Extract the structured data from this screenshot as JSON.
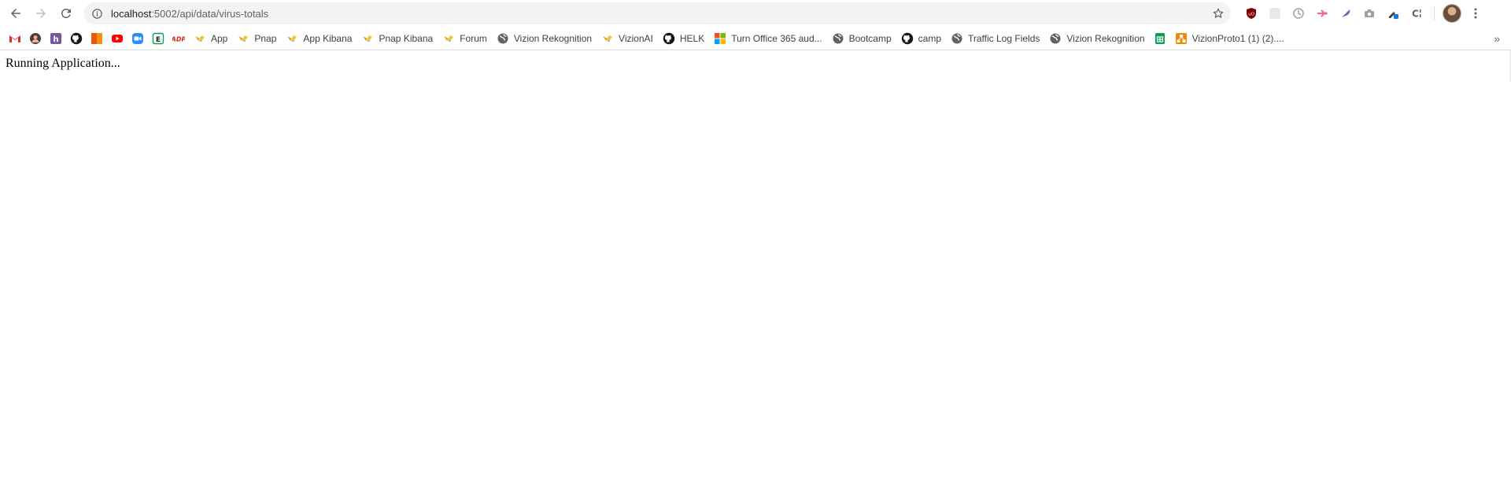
{
  "toolbar": {
    "url_host": "localhost",
    "url_path": ":5002/api/data/virus-totals"
  },
  "bookmarks": {
    "items": [
      {
        "label": "",
        "icon": "gmail-icon"
      },
      {
        "label": "",
        "icon": "avatar-bookmark-icon"
      },
      {
        "label": "",
        "icon": "heroku-icon"
      },
      {
        "label": "",
        "icon": "github-icon"
      },
      {
        "label": "",
        "icon": "orange-bookmark-icon"
      },
      {
        "label": "",
        "icon": "youtube-icon"
      },
      {
        "label": "",
        "icon": "zoom-icon"
      },
      {
        "label": "",
        "icon": "evernote-e-icon"
      },
      {
        "label": "",
        "icon": "adp-icon"
      },
      {
        "label": "App",
        "icon": "kibana-leaf-icon"
      },
      {
        "label": "Pnap",
        "icon": "kibana-leaf-icon"
      },
      {
        "label": "App Kibana",
        "icon": "kibana-leaf-icon"
      },
      {
        "label": "Pnap Kibana",
        "icon": "kibana-leaf-icon"
      },
      {
        "label": "Forum",
        "icon": "kibana-leaf-icon"
      },
      {
        "label": "Vizion Rekognition",
        "icon": "globe-icon"
      },
      {
        "label": "VizionAI",
        "icon": "kibana-leaf-icon"
      },
      {
        "label": "HELK",
        "icon": "github-icon"
      },
      {
        "label": "Turn Office 365 aud...",
        "icon": "microsoft-icon"
      },
      {
        "label": "Bootcamp",
        "icon": "globe-icon"
      },
      {
        "label": "camp",
        "icon": "github-icon"
      },
      {
        "label": "Traffic Log Fields",
        "icon": "globe-icon"
      },
      {
        "label": "Vizion Rekognition",
        "icon": "globe-icon"
      },
      {
        "label": "",
        "icon": "google-sheets-icon"
      },
      {
        "label": "VizionProto1 (1) (2)....",
        "icon": "drawio-icon"
      }
    ],
    "more_label": "»"
  },
  "page": {
    "text": "Running Application..."
  },
  "colors": {
    "omnibox_bg": "#f1f3f4",
    "text": "#202124",
    "muted": "#5f6368"
  }
}
